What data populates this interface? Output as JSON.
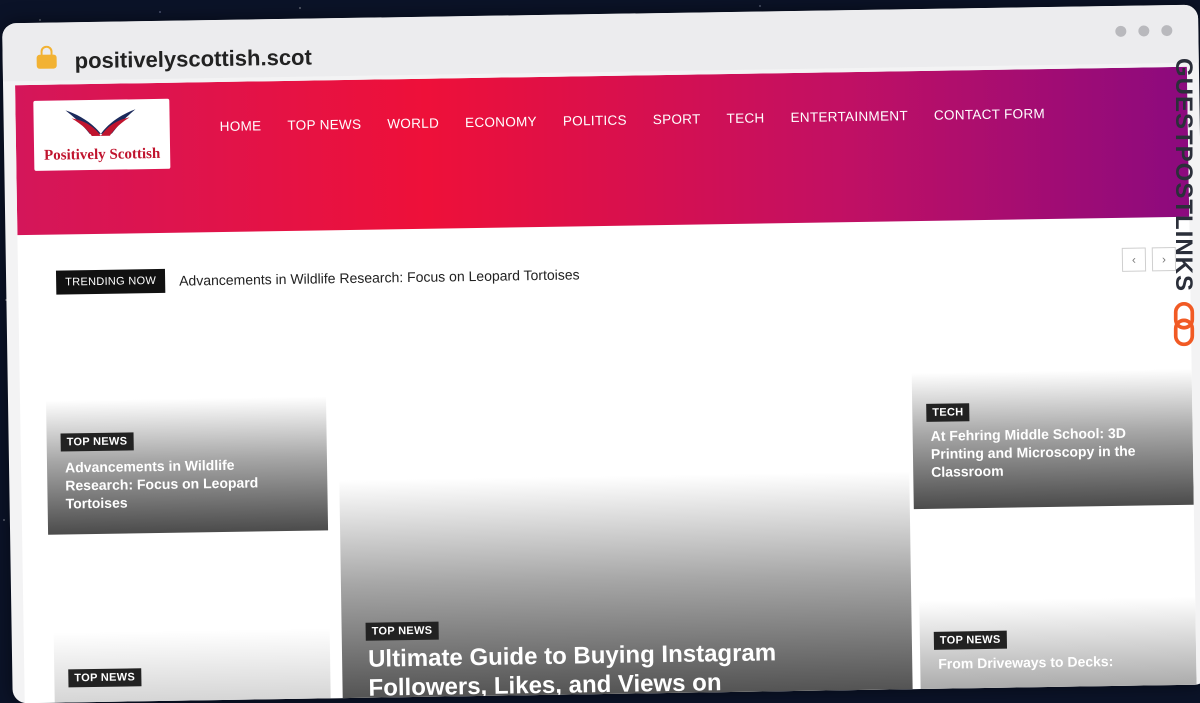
{
  "browser": {
    "url": "positivelyscottish.scot"
  },
  "site": {
    "logo_text": "Positively Scottish",
    "nav": [
      "HOME",
      "TOP NEWS",
      "WORLD",
      "ECONOMY",
      "POLITICS",
      "SPORT",
      "TECH",
      "ENTERTAINMENT",
      "CONTACT FORM"
    ]
  },
  "trending": {
    "badge": "TRENDING NOW",
    "headline": "Advancements in Wildlife Research: Focus on Leopard Tortoises",
    "prev_icon": "‹",
    "next_icon": "›"
  },
  "cards": {
    "left_top": {
      "category": "TOP NEWS",
      "title": "Advancements in Wildlife Research: Focus on Leopard Tortoises"
    },
    "left_bottom": {
      "category": "TOP NEWS",
      "title": ""
    },
    "main": {
      "category": "TOP NEWS",
      "title": "Ultimate Guide to Buying Instagram Followers, Likes, and Views on"
    },
    "right_top": {
      "category": "TECH",
      "title": "At Fehring Middle School: 3D Printing and Microscopy in the Classroom"
    },
    "right_bottom": {
      "category": "TOP NEWS",
      "title": "From Driveways to Decks:"
    }
  },
  "watermark": {
    "text": "GUESTPOSTLINKS"
  },
  "colors": {
    "header_start": "#d4165a",
    "header_mid": "#ee1039",
    "header_end": "#8c0a7e",
    "lock": "#f2b233",
    "watermark_icon": "#f15a24"
  }
}
